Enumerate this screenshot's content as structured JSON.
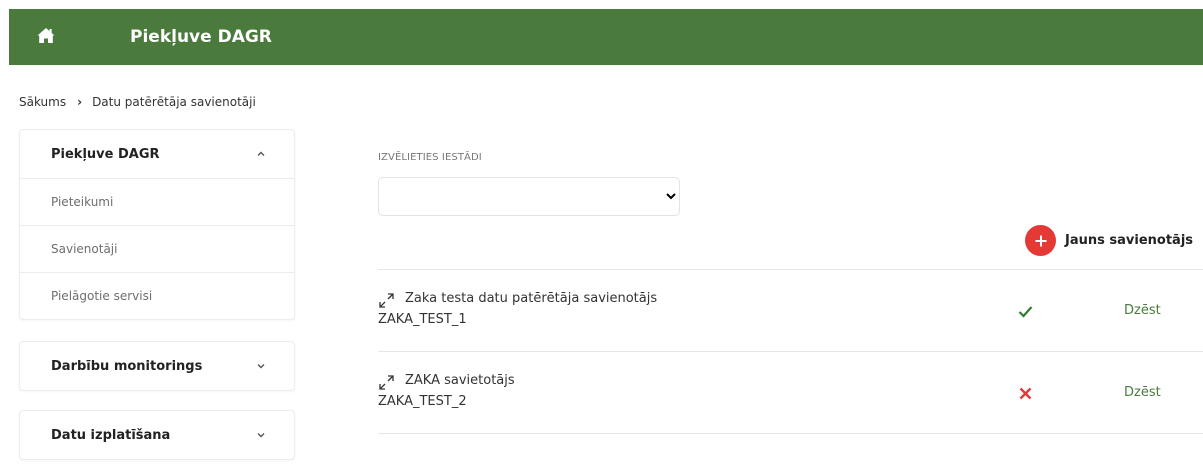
{
  "header": {
    "app_title": "Piekļuve DAGR",
    "home_icon": "home-icon",
    "background_color": "#4a7a3c"
  },
  "breadcrumb": {
    "items": [
      "Sākums",
      "Datu patērētāja savienotāji"
    ],
    "separator_icon": "chevron-right-icon"
  },
  "sidebar": {
    "panels": [
      {
        "title": "Piekļuve DAGR",
        "expanded": true,
        "items": [
          "Pieteikumi",
          "Savienotāji",
          "Pielāgotie servisi"
        ]
      },
      {
        "title": "Darbību monitorings",
        "expanded": false,
        "items": []
      },
      {
        "title": "Datu izplatīšana",
        "expanded": false,
        "items": []
      }
    ]
  },
  "main": {
    "institution_label": "IZVĒLIETIES IESTĀDI",
    "institution_value": "",
    "new_button_label": "Jauns savienotājs",
    "new_button_color": "#e53935",
    "connectors": [
      {
        "name": "Zaka testa datu patērētāja savienotājs",
        "code": "ZAKA_TEST_1",
        "status": "active",
        "status_icon": "checkmark-icon",
        "status_color": "#2e7d32",
        "delete_label": "Dzēst"
      },
      {
        "name": "ZAKA savietotājs",
        "code": "ZAKA_TEST_2",
        "status": "inactive",
        "status_icon": "cross-icon",
        "status_color": "#e53935",
        "delete_label": "Dzēst"
      }
    ]
  }
}
